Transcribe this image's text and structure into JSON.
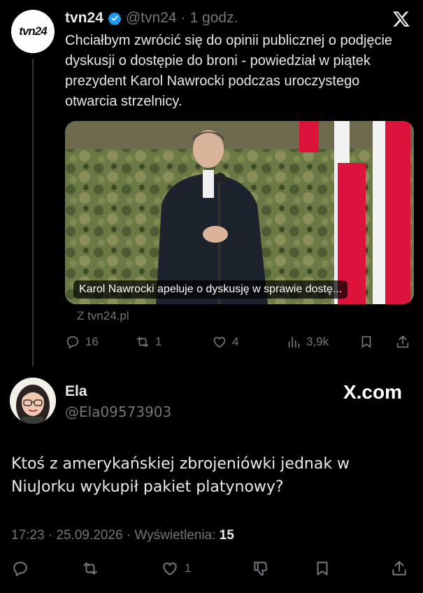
{
  "quoted_tweet": {
    "author_name": "tvn24",
    "author_handle": "@tvn24",
    "separator": "·",
    "time": "1 godz.",
    "avatar_logo": "tvn24",
    "text": "Chciałbym zwrócić się do opinii publicznej o podjęcie dyskusji o dostępie do broni - powiedział w piątek prezydent Karol Nawrocki podczas uroczystego otwarcia strzelnicy.",
    "media_caption": "Karol Nawrocki apeluje o dyskusję w sprawie dostę...",
    "source": "Z tvn24.pl",
    "actions": {
      "replies": "16",
      "reposts": "1",
      "likes": "4",
      "views": "3,9k"
    },
    "icons": [
      "verified-badge-icon",
      "x-logo-icon",
      "reply-icon",
      "repost-icon",
      "like-icon",
      "views-icon",
      "bookmark-icon",
      "share-icon"
    ]
  },
  "reply": {
    "author_name": "Ela",
    "author_handle": "@Ela09573903",
    "watermark": "X.com",
    "text": "Ktoś z amerykańskiej zbrojeniówki jednak w NiuJorku wykupił pakiet platynowy?",
    "meta_time": "17:23 · 25.09.2026 · Wyświetlenia:",
    "meta_views": "15",
    "actions": {
      "likes": "1"
    },
    "icons": [
      "reply-icon",
      "repost-icon",
      "like-icon",
      "dislike-icon",
      "bookmark-icon",
      "share-icon"
    ]
  },
  "colors": {
    "background": "#000000",
    "text": "#e7e9ea",
    "muted": "#71767b",
    "verified": "#1d9bf0",
    "flag_red": "#dc143c"
  }
}
